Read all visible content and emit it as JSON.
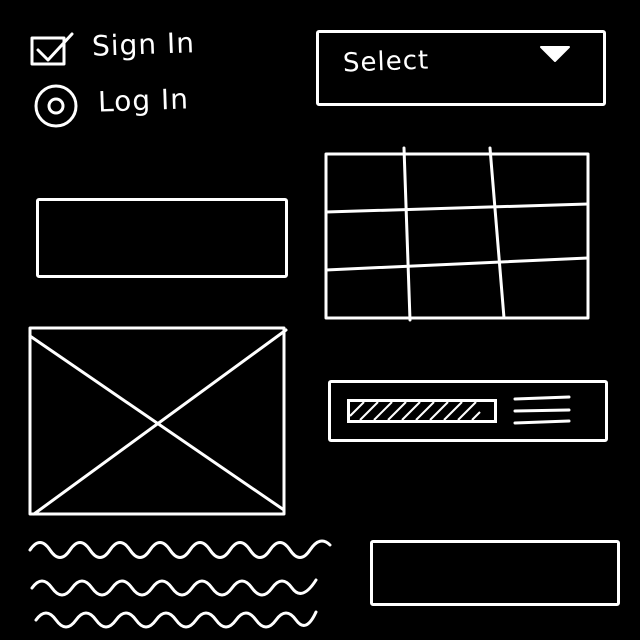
{
  "auth_options": {
    "sign_in_label": "Sign In",
    "log_in_label": "Log In",
    "sign_in_checked": true,
    "log_in_selected": true
  },
  "dropdown": {
    "selected_value": "Select",
    "icon": "chevron-down-icon"
  },
  "grid_table": {
    "rows": 3,
    "columns": 3
  },
  "progress": {
    "fill_fraction": 0.9
  },
  "colors": {
    "background": "#000000",
    "stroke": "#ffffff"
  }
}
